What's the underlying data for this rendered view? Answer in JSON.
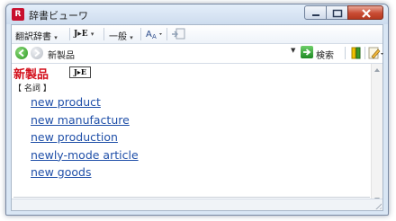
{
  "window": {
    "title": "辞書ビューワ"
  },
  "toolbar1": {
    "dictionary_menu": "翻訳辞書",
    "je_label": "J▸E",
    "general_label": "一般",
    "caret": "▾"
  },
  "toolbar2": {
    "search_value": "新製品",
    "search_button": "検索"
  },
  "entry": {
    "headword": "新製品",
    "dict_badge": "J▸E",
    "part_of_speech": "【 名詞 】",
    "translations": [
      "new product",
      "new manufacture",
      "new production",
      "newly-mode article",
      "new goods"
    ]
  },
  "colors": {
    "headword": "#d3101c",
    "link": "#1f4fa8",
    "close_button": "#c94c34"
  },
  "icons": {
    "app": "dictionary-app-icon",
    "back": "green-back-arrow-icon",
    "forward": "gray-forward-arrow-icon",
    "search_go": "green-go-arrow-icon",
    "bookmark": "bookmark-icon",
    "note": "note-edit-icon"
  }
}
